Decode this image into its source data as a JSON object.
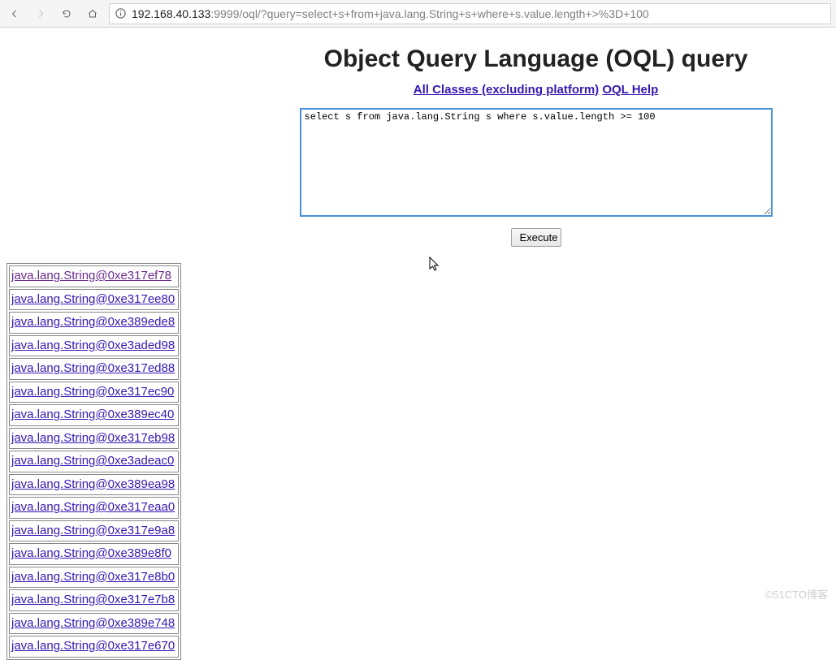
{
  "browser": {
    "url_host_prefix": "",
    "url_host": "192.168.40.133",
    "url_rest": ":9999/oql/?query=select+s+from+java.lang.String+s+where+s.value.length+>%3D+100"
  },
  "page": {
    "title": "Object Query Language (OQL) query",
    "link_all_classes": "All Classes (excluding platform)",
    "link_oql_help": "OQL Help",
    "query_value": "select s from java.lang.String s where s.value.length >= 100",
    "execute_label": "Execute"
  },
  "results": [
    {
      "text": "java.lang.String@0xe317ef78",
      "visited": true
    },
    {
      "text": "java.lang.String@0xe317ee80",
      "visited": false
    },
    {
      "text": "java.lang.String@0xe389ede8",
      "visited": false
    },
    {
      "text": "java.lang.String@0xe3aded98",
      "visited": false
    },
    {
      "text": "java.lang.String@0xe317ed88",
      "visited": false
    },
    {
      "text": "java.lang.String@0xe317ec90",
      "visited": false
    },
    {
      "text": "java.lang.String@0xe389ec40",
      "visited": false
    },
    {
      "text": "java.lang.String@0xe317eb98",
      "visited": false
    },
    {
      "text": "java.lang.String@0xe3adeac0",
      "visited": false
    },
    {
      "text": "java.lang.String@0xe389ea98",
      "visited": false
    },
    {
      "text": "java.lang.String@0xe317eaa0",
      "visited": false
    },
    {
      "text": "java.lang.String@0xe317e9a8",
      "visited": false
    },
    {
      "text": "java.lang.String@0xe389e8f0",
      "visited": false
    },
    {
      "text": "java.lang.String@0xe317e8b0",
      "visited": false
    },
    {
      "text": "java.lang.String@0xe317e7b8",
      "visited": false
    },
    {
      "text": "java.lang.String@0xe389e748",
      "visited": false
    },
    {
      "text": "java.lang.String@0xe317e670",
      "visited": false
    }
  ],
  "watermark": "©51CTO博客"
}
